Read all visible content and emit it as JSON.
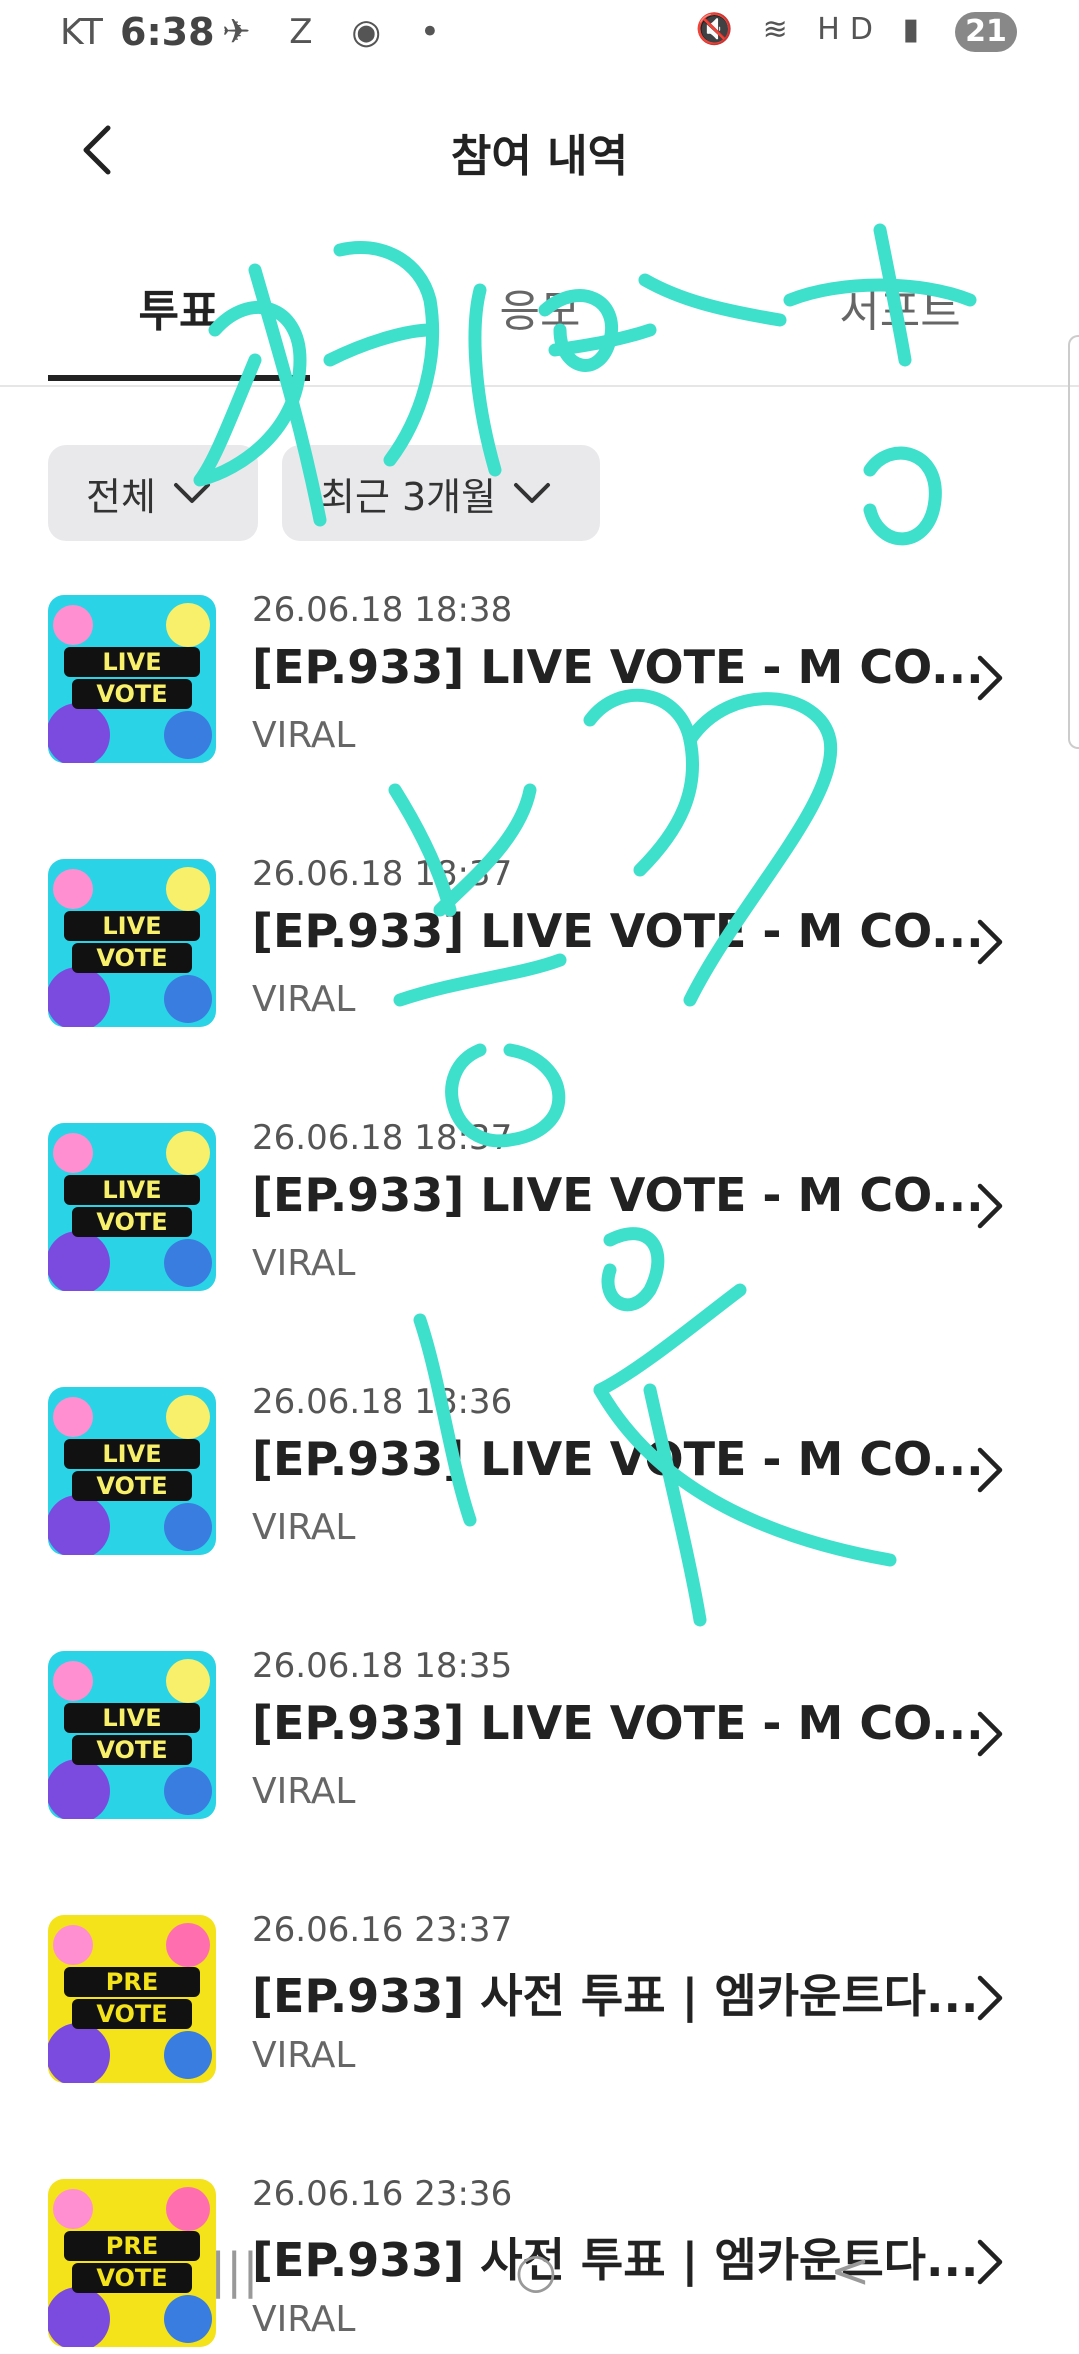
{
  "status_bar": {
    "carrier": "KT",
    "time": "6:38",
    "left_icons": "✈ Z ◉ •",
    "right_icons": "🔇 ≋ HD ▮",
    "battery": "21"
  },
  "header": {
    "title": "참여 내역"
  },
  "tabs": [
    {
      "label": "투표",
      "active": true
    },
    {
      "label": "응모",
      "active": false
    },
    {
      "label": "서포트",
      "active": false
    }
  ],
  "filters": [
    {
      "label": "전체"
    },
    {
      "label": "최근 3개월"
    }
  ],
  "items": [
    {
      "date": "26.06.18 18:38",
      "title": "[EP.933] LIVE VOTE - M CO...",
      "category": "VIRAL",
      "thumb_line1": "LIVE",
      "thumb_line2": "VOTE"
    },
    {
      "date": "26.06.18 18:37",
      "title": "[EP.933] LIVE VOTE - M CO...",
      "category": "VIRAL",
      "thumb_line1": "LIVE",
      "thumb_line2": "VOTE"
    },
    {
      "date": "26.06.18 18:37",
      "title": "[EP.933] LIVE VOTE - M CO...",
      "category": "VIRAL",
      "thumb_line1": "LIVE",
      "thumb_line2": "VOTE"
    },
    {
      "date": "26.06.18 18:36",
      "title": "[EP.933] LIVE VOTE - M CO...",
      "category": "VIRAL",
      "thumb_line1": "LIVE",
      "thumb_line2": "VOTE"
    },
    {
      "date": "26.06.18 18:35",
      "title": "[EP.933] LIVE VOTE - M CO...",
      "category": "VIRAL",
      "thumb_line1": "LIVE",
      "thumb_line2": "VOTE"
    },
    {
      "date": "26.06.16 23:37",
      "title": "[EP.933] 사전 투표 | 엠카운트다...",
      "category": "VIRAL",
      "thumb_line1": "PRE",
      "thumb_line2": "VOTE"
    },
    {
      "date": "26.06.16 23:36",
      "title": "[EP.933] 사전 투표 | 엠카운트다...",
      "category": "VIRAL",
      "thumb_line1": "PRE",
      "thumb_line2": "VOTE"
    }
  ],
  "nav_bar": {
    "recents": "|||",
    "home": "○",
    "back": "<"
  },
  "colors": {
    "handwriting": "#3ee0cc",
    "live_thumb_bg": "#2ad3e6",
    "pre_thumb_bg": "#f4e21b"
  }
}
